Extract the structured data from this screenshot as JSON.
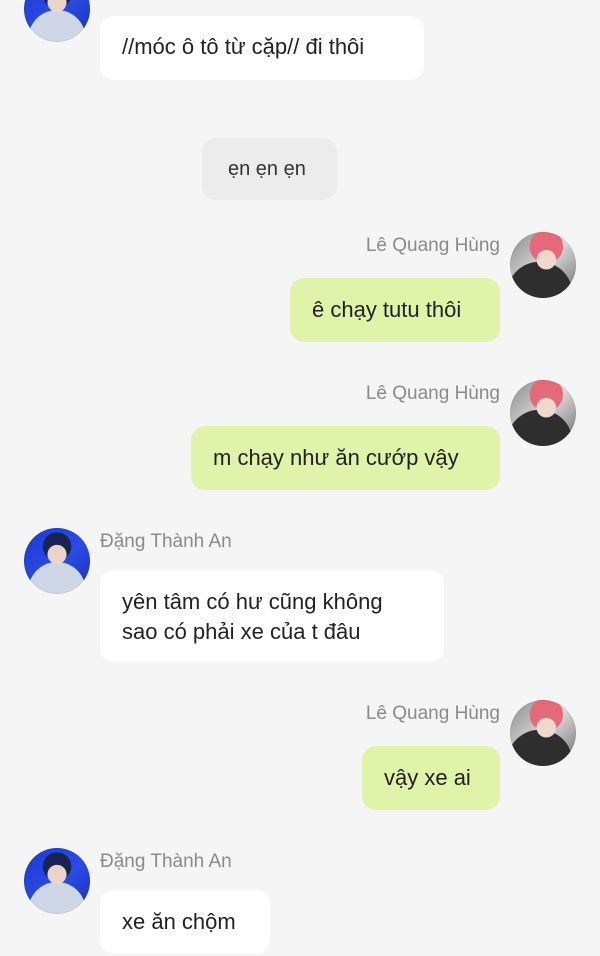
{
  "messages": [
    {
      "text": "//móc ô tô từ cặp// đi thôi"
    },
    {
      "text": "ẹn ẹn ẹn"
    },
    {
      "sender": "Lê Quang Hùng",
      "text": "ê chạy tutu thôi"
    },
    {
      "sender": "Lê Quang Hùng",
      "text": "m chạy như ăn cướp vậy"
    },
    {
      "sender": "Đặng Thành An",
      "text": "yên tâm có hư cũng không\nsao có phải xe của t đâu"
    },
    {
      "sender": "Lê Quang Hùng",
      "text": "vậy xe ai"
    },
    {
      "sender": "Đặng Thành An",
      "text": "xe ăn chộm"
    }
  ],
  "colors": {
    "background": "#f5f5f5",
    "incoming_bubble": "#ffffff",
    "outgoing_bubble": "#dff3a9",
    "system_bubble": "#ececec",
    "sender_name": "#8a8a8a"
  }
}
